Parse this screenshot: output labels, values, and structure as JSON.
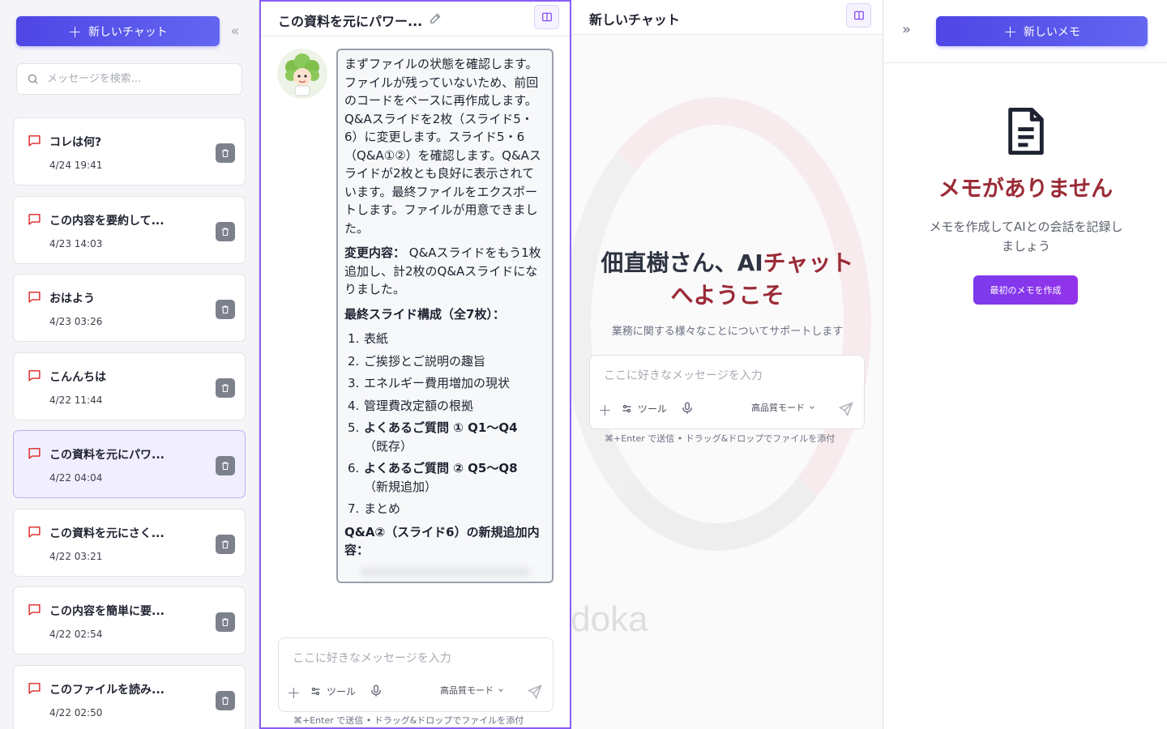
{
  "sidebar": {
    "new_chat_label": "新しいチャット",
    "search_placeholder": "メッセージを検索...",
    "conversations": [
      {
        "title": "コレは何?",
        "date": "4/24 19:41",
        "active": false
      },
      {
        "title": "この内容を要約して...",
        "date": "4/23 14:03",
        "active": false
      },
      {
        "title": "おはよう",
        "date": "4/23 03:26",
        "active": false
      },
      {
        "title": "こんんちは",
        "date": "4/22 11:44",
        "active": false
      },
      {
        "title": "この資料を元にパワ...",
        "date": "4/22 04:04",
        "active": true
      },
      {
        "title": "この資料を元にさく...",
        "date": "4/22 03:21",
        "active": false
      },
      {
        "title": "この内容を簡単に要...",
        "date": "4/22 02:54",
        "active": false
      },
      {
        "title": "このファイルを読み...",
        "date": "4/22 02:50",
        "active": false
      }
    ]
  },
  "chat1": {
    "title": "この資料を元にパワー...",
    "message": {
      "intro": "まずファイルの状態を確認します。ファイルが残っていないため、前回のコードをベースに再作成します。Q&Aスライドを2枚（スライド5・6）に変更します。スライド5・6（Q&A①②）を確認します。Q&Aスライドが2枚とも良好に表示されています。最終ファイルをエクスポートします。ファイルが用意できました。",
      "change_label": "変更内容：",
      "change_text": " Q&Aスライドをもう1枚追加し、計2枚のQ&Aスライドになりました。",
      "structure_heading": "最終スライド構成（全7枚）：",
      "slides": [
        {
          "num": "1.",
          "text": "表紙",
          "bold": "",
          "sub": ""
        },
        {
          "num": "2.",
          "text": "ご挨拶とご説明の趣旨",
          "bold": "",
          "sub": ""
        },
        {
          "num": "3.",
          "text": "エネルギー費用増加の現状",
          "bold": "",
          "sub": ""
        },
        {
          "num": "4.",
          "text": "管理費改定額の根拠",
          "bold": "",
          "sub": ""
        },
        {
          "num": "5.",
          "text": "",
          "bold": "よくあるご質問 ① Q1〜Q4",
          "sub": "（既存）"
        },
        {
          "num": "6.",
          "text": "",
          "bold": "よくあるご質問 ② Q5〜Q8",
          "sub": "（新規追加）"
        },
        {
          "num": "7.",
          "text": "まとめ",
          "bold": "",
          "sub": ""
        }
      ],
      "qa_heading": "Q&A②（スライド6）の新規追加内容："
    },
    "input_placeholder": "ここに好きなメッセージを入力",
    "tools_label": "ツール",
    "mode_label": "高品質モード",
    "hint": "⌘+Enter で送信 • ドラッグ&ドロップでファイルを添付"
  },
  "chat2": {
    "title": "新しいチャット",
    "welcome_part1": "佃直樹さん、AI",
    "welcome_part2": "チャット",
    "welcome_part3": "へようこそ",
    "subtitle": "業務に関する様々なことについてサポートします",
    "watermark": "Madoka",
    "input_placeholder": "ここに好きなメッセージを入力",
    "tools_label": "ツール",
    "mode_label": "高品質モード",
    "hint": "⌘+Enter で送信 • ドラッグ&ドロップでファイルを添付"
  },
  "memo": {
    "new_memo_label": "新しいメモ",
    "empty_title": "メモがありません",
    "empty_desc": "メモを作成してAIとの会話を記録しましょう",
    "first_memo_label": "最初のメモを作成"
  },
  "colors": {
    "primary": "#4f46e5",
    "accent_red": "#9b2b37",
    "active_border": "#8b5cf6",
    "chat_icon": "#dc2626"
  },
  "icons": [
    "plus-icon",
    "collapse-left-icon",
    "search-icon",
    "chat-bubble-icon",
    "trash-icon",
    "edit-icon",
    "split-view-icon",
    "mic-icon",
    "sliders-icon",
    "send-icon",
    "chevron-down-icon",
    "expand-right-icon",
    "document-icon"
  ]
}
